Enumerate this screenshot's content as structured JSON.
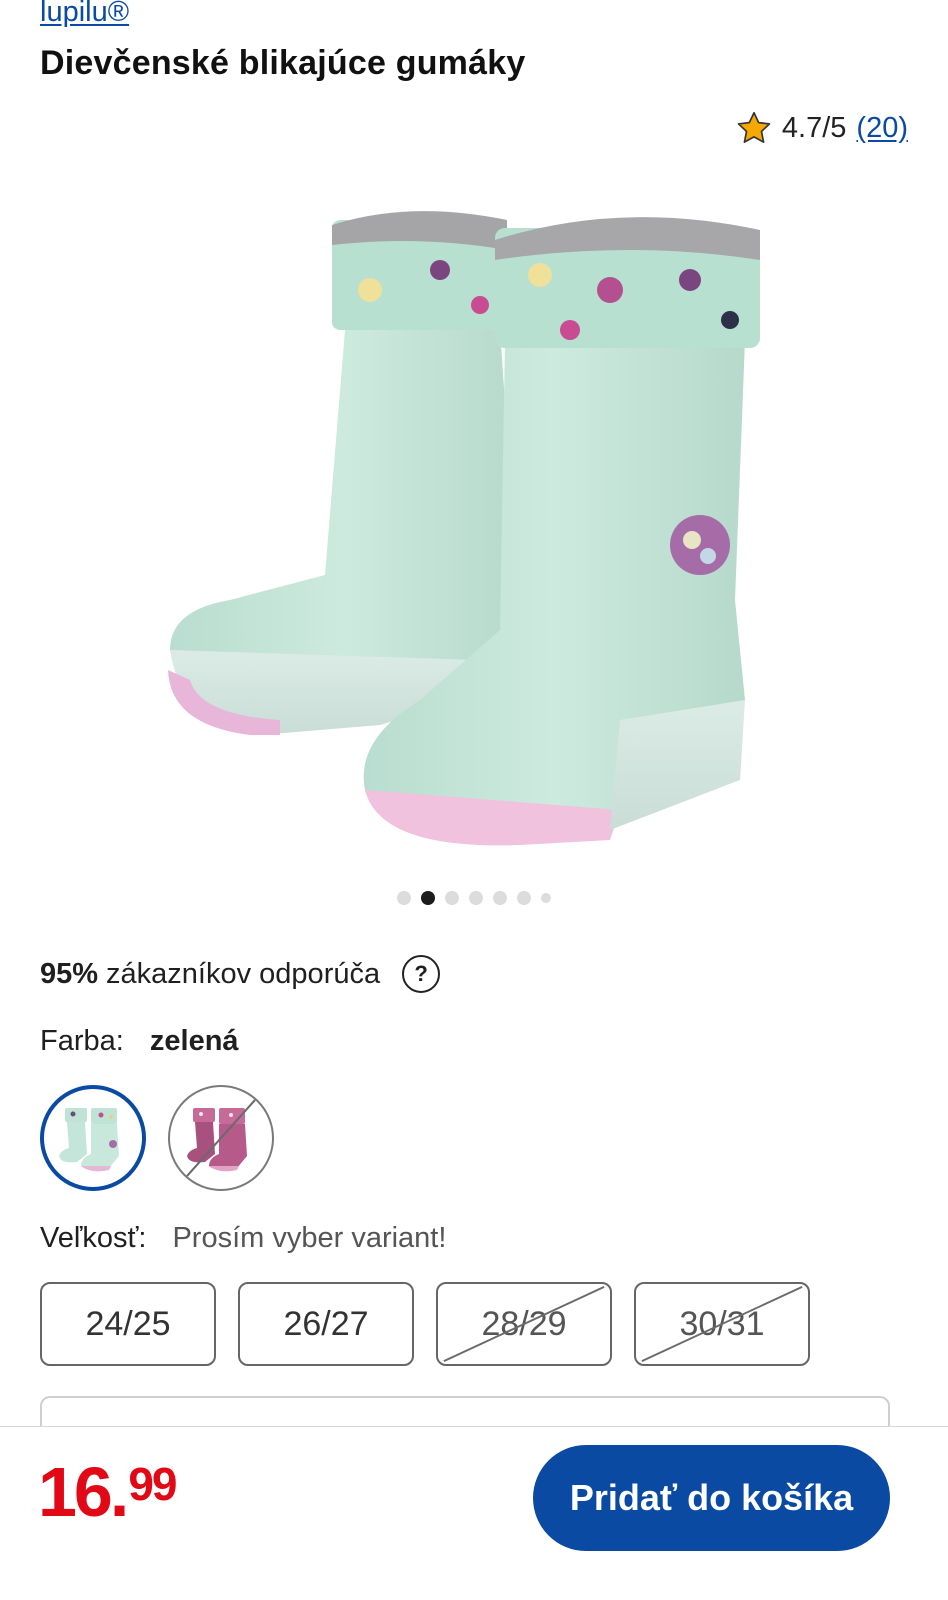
{
  "product": {
    "brand": "lupilu®",
    "title": "Dievčenské blikajúce gumáky",
    "rating": "4.7/5",
    "rating_count": "(20)"
  },
  "gallery": {
    "image": "mint green rain boots with acorn-print fleece cuff and pink sole",
    "total_images": 7,
    "active_index": 2
  },
  "recommend": {
    "percent": "95%",
    "text": "zákazníkov odporúča",
    "help_icon": "?"
  },
  "color": {
    "label": "Farba:",
    "value": "zelená",
    "swatches": [
      {
        "name": "zelená",
        "selected": true,
        "available": true,
        "fill": "#c7e8dd"
      },
      {
        "name": "ružová",
        "selected": false,
        "available": false,
        "fill": "#b05b86"
      }
    ]
  },
  "size": {
    "label": "Veľkosť:",
    "hint": "Prosím vyber variant!",
    "options": [
      {
        "label": "24/25",
        "available": true
      },
      {
        "label": "26/27",
        "available": true
      },
      {
        "label": "28/29",
        "available": false
      },
      {
        "label": "30/31",
        "available": false
      }
    ]
  },
  "footer": {
    "price_whole": "16.",
    "price_cents": "99",
    "add_to_cart": "Pridať do košíka"
  },
  "colors": {
    "brand_blue": "#0b4aa2",
    "price_red": "#e10915",
    "star": "#f5a800"
  }
}
